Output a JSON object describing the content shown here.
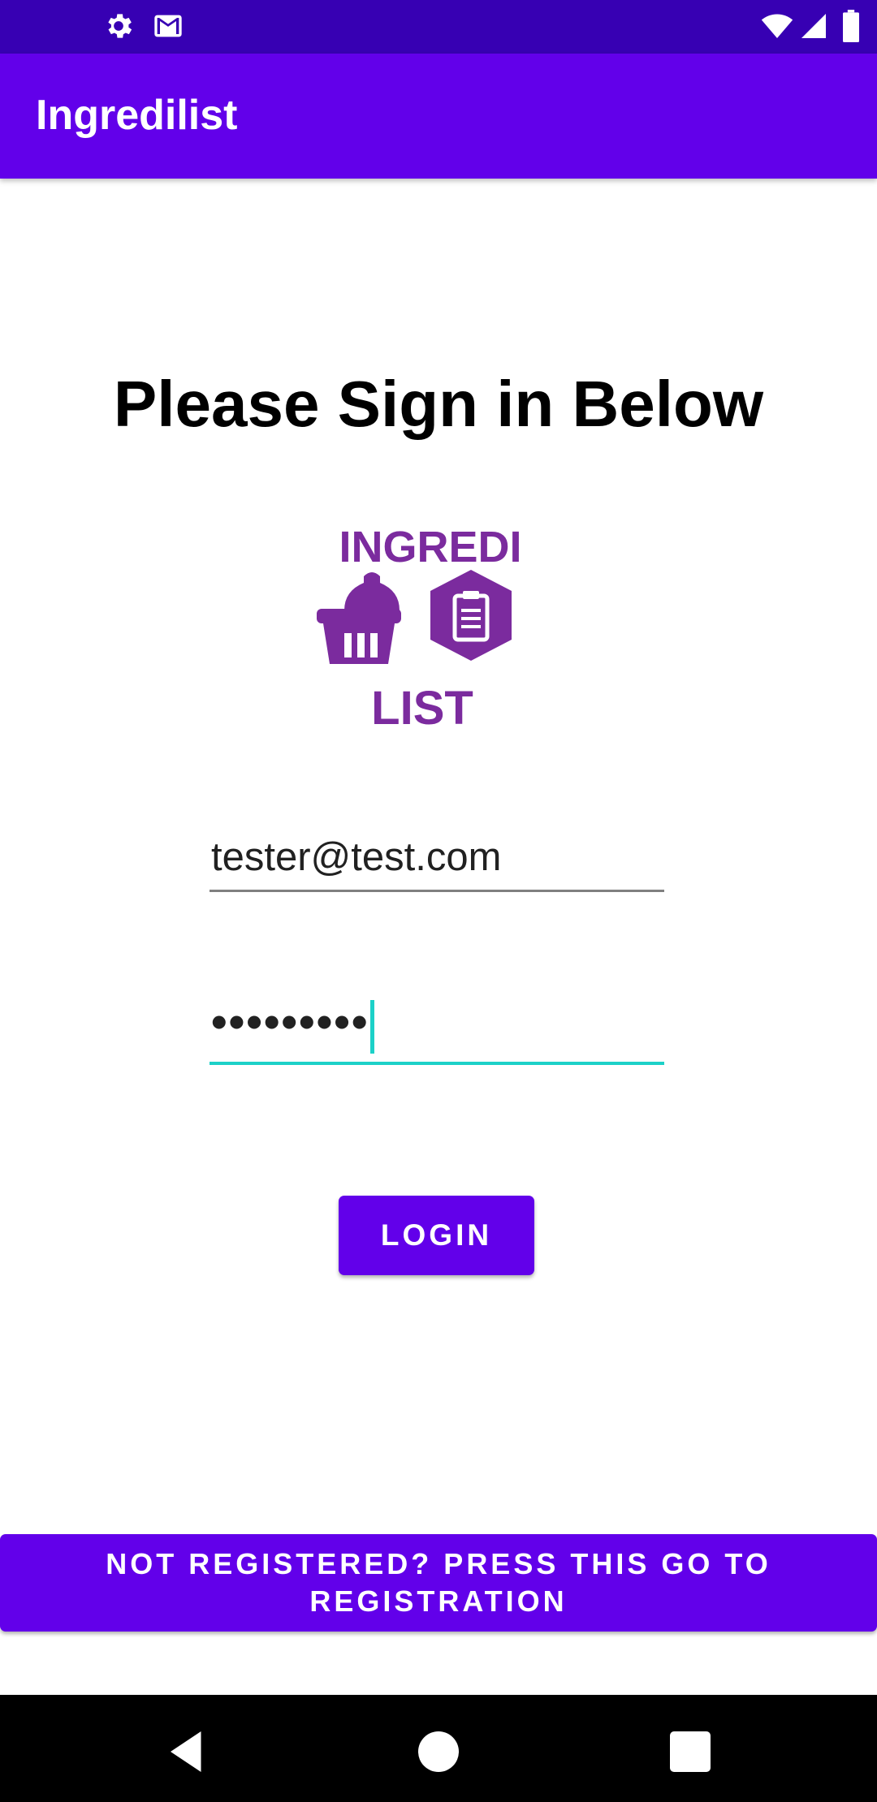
{
  "app": {
    "title": "Ingredilist"
  },
  "status_bar": {
    "left_icons": [
      "settings-icon",
      "gmail-icon"
    ],
    "right_icons": [
      "wifi-icon",
      "signal-icon",
      "battery-icon"
    ]
  },
  "login": {
    "heading": "Please Sign in Below",
    "email_value": "tester@test.com",
    "password_value": "•••••••••",
    "login_button": "LOGIN",
    "register_button": "NOT REGISTERED? PRESS THIS GO TO REGISTRATION"
  },
  "logo": {
    "top_text": "INGREDI",
    "bottom_text": "LIST",
    "color": "#7b2b9e"
  },
  "colors": {
    "status_bar": "#3700b3",
    "app_bar": "#6200ea",
    "accent": "#1cd1c8",
    "button": "#6200ea"
  },
  "navigation": {
    "buttons": [
      "back-icon",
      "home-icon",
      "recents-icon"
    ]
  }
}
